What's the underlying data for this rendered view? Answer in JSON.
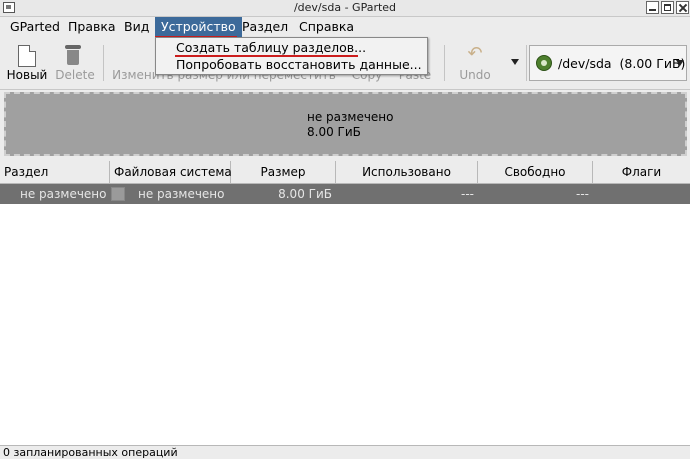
{
  "window": {
    "title": "/dev/sda - GParted"
  },
  "menubar": {
    "items": [
      "GParted",
      "Правка",
      "Вид",
      "Устройство",
      "Раздел",
      "Справка"
    ],
    "active": "Устройство"
  },
  "device_menu": {
    "items": [
      "Создать таблицу разделов...",
      "Попробовать восстановить данные..."
    ]
  },
  "toolbar": {
    "new_label": "Новый",
    "delete_label": "Delete",
    "resize_label": "Изменить размер или переместить",
    "copy_label": "Copy",
    "paste_label": "Paste",
    "undo_label": "Undo"
  },
  "device_selector": {
    "device": "/dev/sda",
    "size": "(8.00 ГиБ)"
  },
  "disk_map": {
    "line1": "не размечено",
    "line2": "8.00 ГиБ"
  },
  "table": {
    "columns": [
      "Раздел",
      "Файловая система",
      "Размер",
      "Использовано",
      "Свободно",
      "Флаги"
    ],
    "rows": [
      {
        "partition": "не размечено",
        "filesystem": "не размечено",
        "size": "8.00 ГиБ",
        "used": "---",
        "free": "---",
        "flags": ""
      }
    ]
  },
  "statusbar": {
    "text": "0 запланированных операций"
  },
  "colors": {
    "menu_highlight": "#3c6a9a",
    "annotation_underline": "#cc1d1d",
    "unallocated": "#a0a0a0",
    "selected_row": "#707070"
  }
}
